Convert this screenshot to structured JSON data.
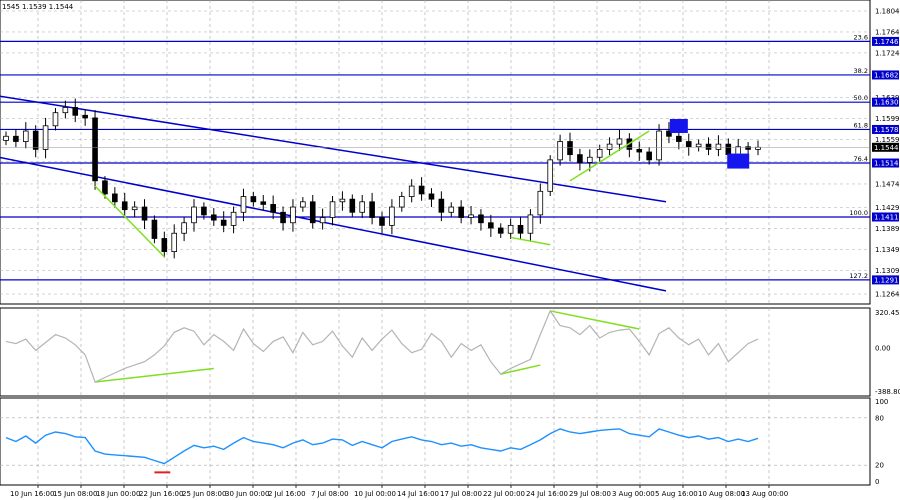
{
  "header": {
    "ohlc_text": "1545 1.1539 1.1544"
  },
  "colors": {
    "candle": "#000000",
    "level_line": "#0000cc",
    "channel_line": "#0000cc",
    "divergence": "#7fe01f",
    "cci_line": "#b4b4b4",
    "rsi_line": "#1e90ff",
    "rsi_marker": "#e02020",
    "marker_box": "#1515ee",
    "grid": "#a8a8a8"
  },
  "chart_data": [
    {
      "type": "candlestick",
      "pane": "price",
      "ylim": [
        1.1245,
        1.1825
      ],
      "y_ticks": [
        "1.1804",
        "1.1764",
        "1.1724",
        "1.1682",
        "1.1639",
        "1.1599",
        "1.1559",
        "1.1517",
        "1.1474",
        "1.1429",
        "1.1389",
        "1.1349",
        "1.1309",
        "1.1264"
      ],
      "x_tick_labels": [
        "10 Jun 16:00",
        "15 Jun 08:00",
        "18 Jun 00:00",
        "22 Jun 16:00",
        "25 Jun 08:00",
        "30 Jun 00:00",
        "2 Jul 16:00",
        "7 Jul 08:00",
        "10 Jul 00:00",
        "14 Jul 16:00",
        "17 Jul 08:00",
        "22 Jul 00:00",
        "24 Jul 16:00",
        "29 Jul 08:00",
        "3 Aug 00:00",
        "5 Aug 16:00",
        "10 Aug 08:00",
        "13 Aug 00:00"
      ],
      "fib_levels": [
        {
          "ratio": "23.6",
          "price": "1.1746"
        },
        {
          "ratio": "38.2",
          "price": "1.1682"
        },
        {
          "ratio": "50.0",
          "price": "1.1630"
        },
        {
          "ratio": "61.8",
          "price": "1.1578"
        },
        {
          "ratio": "76.4",
          "price": "1.1514"
        },
        {
          "ratio": "100.0",
          "price": "1.1411"
        },
        {
          "ratio": "127.2",
          "price": "1.1291"
        }
      ],
      "current_price": "1.1544",
      "closes_approx": [
        1.1565,
        1.1555,
        1.1575,
        1.154,
        1.1585,
        1.161,
        1.162,
        1.1605,
        1.16,
        1.148,
        1.1455,
        1.144,
        1.1425,
        1.143,
        1.1405,
        1.137,
        1.1345,
        1.138,
        1.14,
        1.143,
        1.1415,
        1.1405,
        1.1395,
        1.142,
        1.145,
        1.144,
        1.1435,
        1.142,
        1.14,
        1.143,
        1.144,
        1.14,
        1.141,
        1.144,
        1.1445,
        1.142,
        1.144,
        1.141,
        1.1395,
        1.143,
        1.145,
        1.147,
        1.1455,
        1.1445,
        1.142,
        1.143,
        1.141,
        1.1415,
        1.14,
        1.139,
        1.138,
        1.1395,
        1.138,
        1.1415,
        1.146,
        1.152,
        1.1555,
        1.153,
        1.1515,
        1.1525,
        1.154,
        1.155,
        1.156,
        1.154,
        1.1535,
        1.152,
        1.1575,
        1.1565,
        1.1555,
        1.1545,
        1.155,
        1.154,
        1.155,
        1.153,
        1.1545,
        1.154,
        1.1544
      ],
      "channel": {
        "upper": {
          "from": {
            "date": "10 Jun 16:00",
            "price": 1.163
          },
          "to": {
            "date": "3 Aug 00:00",
            "price": 1.144
          }
        },
        "lower": {
          "from": {
            "date": "10 Jun 16:00",
            "price": 1.151
          },
          "to": {
            "date": "3 Aug 00:00",
            "price": 1.127
          }
        }
      },
      "grid": true
    },
    {
      "type": "line",
      "pane": "cci",
      "y_ticks": [
        "320.4558",
        "0.00",
        "-388.803"
      ],
      "ylim": [
        -388.803,
        320.4558
      ],
      "values": [
        60,
        40,
        80,
        -20,
        50,
        120,
        90,
        30,
        -60,
        -300,
        -260,
        -220,
        -180,
        -150,
        -120,
        -60,
        20,
        140,
        180,
        150,
        30,
        120,
        60,
        -20,
        170,
        40,
        -30,
        60,
        100,
        -40,
        140,
        30,
        60,
        150,
        20,
        -80,
        90,
        -20,
        80,
        160,
        40,
        -40,
        -10,
        130,
        60,
        -80,
        40,
        -20,
        30,
        -120,
        -230,
        -180,
        -140,
        -100,
        120,
        330,
        200,
        180,
        120,
        200,
        90,
        140,
        160,
        170,
        60,
        -60,
        130,
        180,
        90,
        30,
        80,
        -60,
        40,
        -120,
        -40,
        40,
        80
      ]
    },
    {
      "type": "line",
      "pane": "rsi",
      "y_ticks": [
        "100",
        "80",
        "20",
        "0"
      ],
      "ylim": [
        0,
        100
      ],
      "values": [
        55,
        50,
        57,
        48,
        58,
        62,
        60,
        56,
        55,
        38,
        34,
        33,
        32,
        31,
        30,
        26,
        22,
        30,
        38,
        45,
        42,
        44,
        40,
        48,
        55,
        50,
        48,
        46,
        42,
        48,
        52,
        46,
        48,
        53,
        52,
        45,
        50,
        46,
        42,
        50,
        53,
        56,
        52,
        50,
        46,
        48,
        44,
        46,
        42,
        40,
        38,
        42,
        40,
        46,
        52,
        60,
        66,
        62,
        60,
        62,
        64,
        65,
        66,
        60,
        58,
        56,
        66,
        62,
        58,
        55,
        57,
        53,
        55,
        50,
        53,
        50,
        54
      ]
    }
  ]
}
